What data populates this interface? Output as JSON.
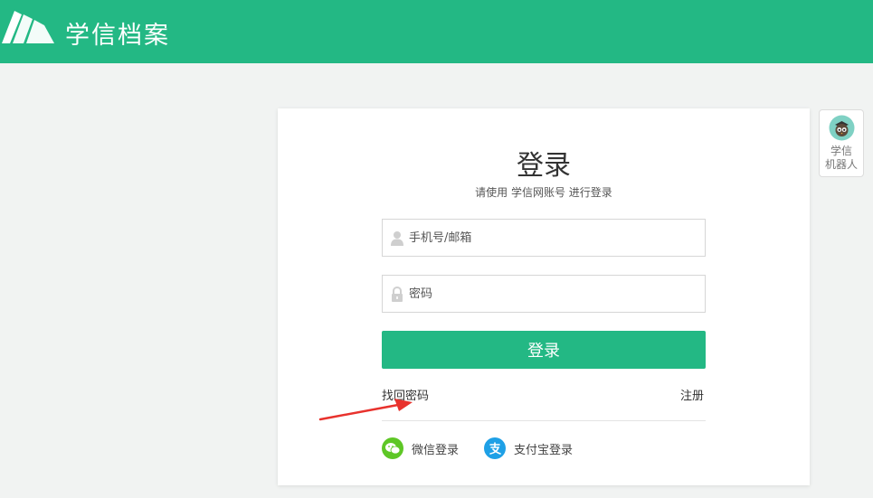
{
  "header": {
    "brand_name": "学信档案"
  },
  "login": {
    "title": "登录",
    "subtitle": "请使用 学信网账号 进行登录",
    "username_placeholder": "手机号/邮箱",
    "password_placeholder": "密码",
    "submit_label": "登录",
    "forgot_password_label": "找回密码",
    "register_label": "注册",
    "social": {
      "wechat_label": "微信登录",
      "alipay_label": "支付宝登录"
    }
  },
  "robot": {
    "line1": "学信",
    "line2": "机器人"
  },
  "colors": {
    "brand_green": "#23b884",
    "wechat_green": "#5ec726",
    "alipay_blue": "#1ea0e6",
    "annotation_red": "#e8322d"
  },
  "icons": {
    "logo": "books-logo-icon",
    "username": "user-icon",
    "password": "lock-icon",
    "wechat": "wechat-icon",
    "alipay": "alipay-icon",
    "robot": "robot-avatar-icon",
    "annotation": "red-arrow-icon"
  }
}
